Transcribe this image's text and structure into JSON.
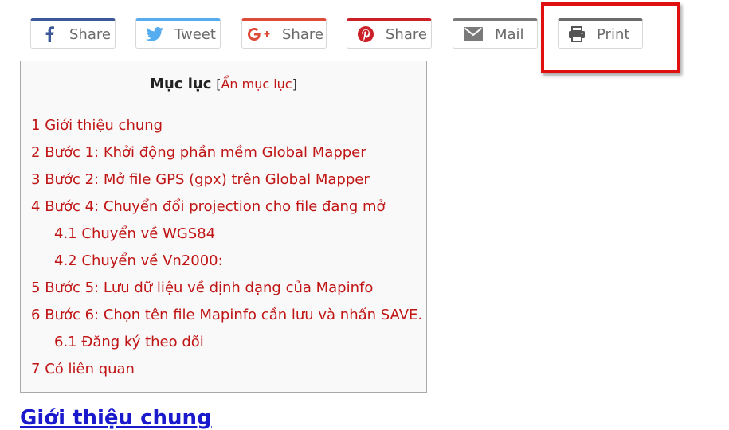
{
  "share": {
    "facebook": {
      "label": "Share",
      "color": "#3b5998"
    },
    "twitter": {
      "label": "Tweet",
      "color": "#55acee"
    },
    "googleplus": {
      "label": "Share",
      "color": "#dd4b39"
    },
    "pinterest": {
      "label": "Share",
      "color": "#cb2027"
    },
    "mail": {
      "label": "Mail",
      "color": "#7a7a7a"
    },
    "print": {
      "label": "Print",
      "color": "#555555"
    }
  },
  "toc": {
    "title": "Mục lục",
    "bracket_open": "[",
    "toggle": "Ẩn mục lục",
    "bracket_close": "]",
    "items": [
      {
        "num": "1",
        "text": "Giới thiệu chung"
      },
      {
        "num": "2",
        "text": "Bước 1: Khởi động phần mềm Global Mapper"
      },
      {
        "num": "3",
        "text": "Bước 2: Mở file GPS (gpx) trên Global Mapper"
      },
      {
        "num": "4",
        "text": "Bước 4: Chuyển đổi projection cho file đang mở"
      },
      {
        "num": "4.1",
        "text": "Chuyển về WGS84"
      },
      {
        "num": "4.2",
        "text": "Chuyển về Vn2000:"
      },
      {
        "num": "5",
        "text": "Bước 5: Lưu dữ liệu về định dạng của Mapinfo"
      },
      {
        "num": "6",
        "text": "Bước 6: Chọn tên file Mapinfo cần lưu và nhấn SAVE."
      },
      {
        "num": "6.1",
        "text": "Đăng ký theo dõi"
      },
      {
        "num": "7",
        "text": "Có liên quan"
      }
    ]
  },
  "section_heading": "Giới thiệu chung",
  "accent": {
    "toc_link": "#c01515",
    "heading_link": "#1a1acc",
    "highlight": "#e01010"
  }
}
